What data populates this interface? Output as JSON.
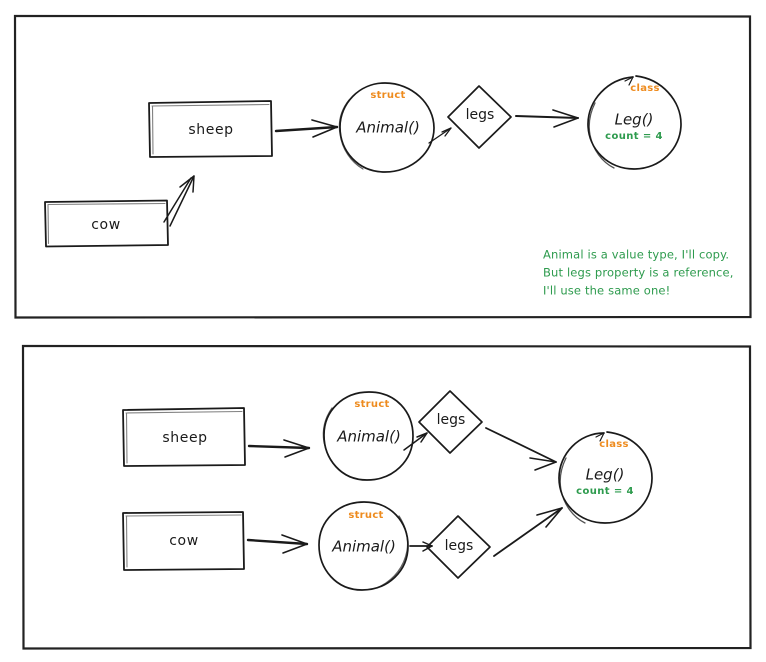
{
  "colors": {
    "ink": "#1a1a1a",
    "frame": "#222222",
    "stereotype_orange": "#ee8b1e",
    "note_green": "#2e9b4e",
    "background": "#ffffff"
  },
  "panels": [
    {
      "id": "panel-top",
      "name": "value-type-copy-panel",
      "boxes": [
        {
          "label": "sheep"
        },
        {
          "label": "cow"
        }
      ],
      "circles": [
        {
          "stereotype": "struct",
          "label": "Animal()",
          "property": ""
        },
        {
          "stereotype": "class",
          "label": "Leg()",
          "property": "count = 4"
        }
      ],
      "diamonds": [
        {
          "label": "legs"
        }
      ],
      "note": {
        "lines": [
          "Animal is a value type, I'll copy.",
          "But legs property is a reference,",
          "I'll use the same one!"
        ]
      }
    },
    {
      "id": "panel-bottom",
      "name": "shared-reference-panel",
      "boxes": [
        {
          "label": "sheep"
        },
        {
          "label": "cow"
        }
      ],
      "circles": [
        {
          "stereotype": "struct",
          "label": "Animal()",
          "property": ""
        },
        {
          "stereotype": "struct",
          "label": "Animal()",
          "property": ""
        },
        {
          "stereotype": "class",
          "label": "Leg()",
          "property": "count = 4"
        }
      ],
      "diamonds": [
        {
          "label": "legs"
        },
        {
          "label": "legs"
        }
      ],
      "note": {
        "lines": []
      }
    }
  ]
}
